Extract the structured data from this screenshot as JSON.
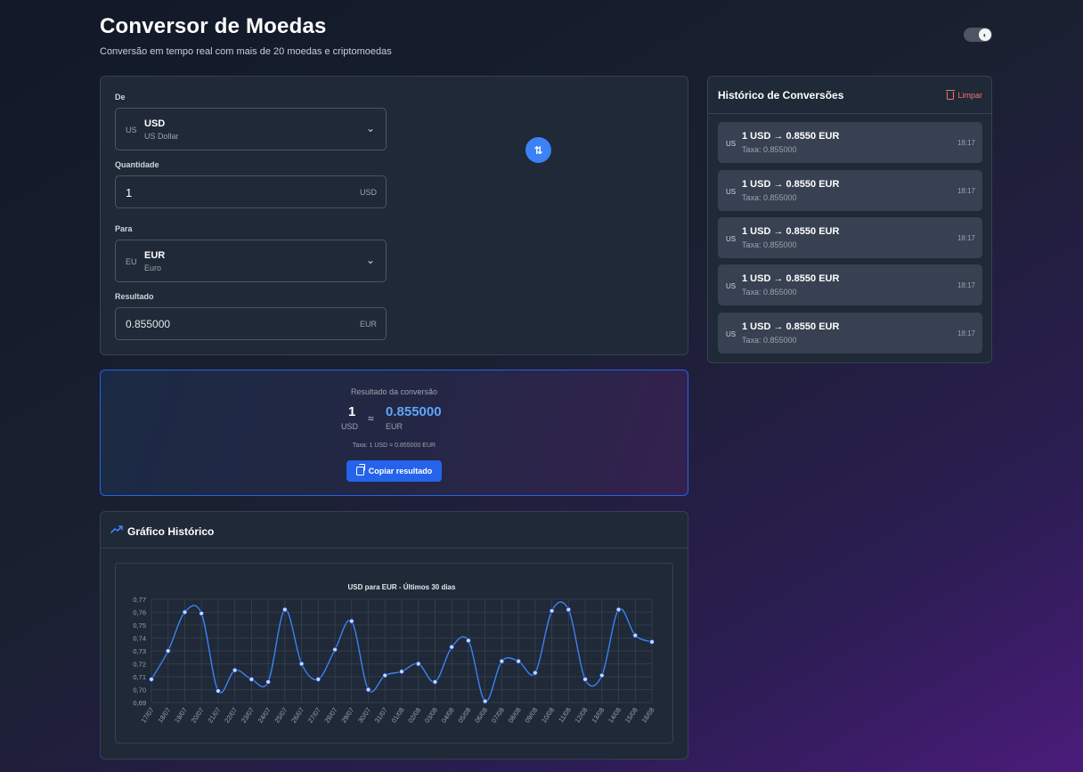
{
  "header": {
    "title": "Conversor de Moedas",
    "subtitle": "Conversão em tempo real com mais de 20 moedas e criptomoedas"
  },
  "converter": {
    "from_label": "De",
    "from": {
      "flag": "US",
      "code": "USD",
      "name": "US Dollar"
    },
    "amount_label": "Quantidade",
    "amount": "1",
    "amount_unit": "USD",
    "to_label": "Para",
    "to": {
      "flag": "EU",
      "code": "EUR",
      "name": "Euro"
    },
    "result_label": "Resultado",
    "result": "0.855000",
    "result_unit": "EUR"
  },
  "result_card": {
    "title": "Resultado da conversão",
    "from_amount": "1",
    "from_code": "USD",
    "approx": "≈",
    "to_amount": "0.855000",
    "to_code": "EUR",
    "rate_text": "Taxa: 1 USD = 0.855000 EUR",
    "copy_label": "Copiar resultado"
  },
  "chart_section": {
    "title": "Gráfico Histórico"
  },
  "chart_data": {
    "type": "line",
    "title": "USD para EUR - Últimos 30 dias",
    "xlabel": "",
    "ylabel": "",
    "ylim": [
      0.69,
      0.77
    ],
    "yticks": [
      "0,77",
      "0,76",
      "0,75",
      "0,74",
      "0,73",
      "0,72",
      "0,71",
      "0,70",
      "0,69"
    ],
    "ytick_values": [
      0.77,
      0.76,
      0.75,
      0.74,
      0.73,
      0.72,
      0.71,
      0.7,
      0.69
    ],
    "categories": [
      "17/07",
      "18/07",
      "19/07",
      "20/07",
      "21/07",
      "22/07",
      "23/07",
      "24/07",
      "25/07",
      "26/07",
      "27/07",
      "28/07",
      "29/07",
      "30/07",
      "31/07",
      "01/08",
      "02/08",
      "03/08",
      "04/08",
      "05/08",
      "06/08",
      "07/08",
      "08/08",
      "09/08",
      "10/08",
      "11/08",
      "12/08",
      "13/08",
      "14/08",
      "15/08",
      "16/08"
    ],
    "series": [
      {
        "values": [
          0.708,
          0.73,
          0.76,
          0.759,
          0.699,
          0.715,
          0.708,
          0.706,
          0.762,
          0.72,
          0.708,
          0.731,
          0.753,
          0.7,
          0.711,
          0.714,
          0.72,
          0.706,
          0.733,
          0.738,
          0.691,
          0.722,
          0.722,
          0.713,
          0.761,
          0.762,
          0.708,
          0.711,
          0.762,
          0.742,
          0.737
        ]
      }
    ],
    "line_color": "#3b82f6",
    "point_fill": "#bfdbfe",
    "grid": true
  },
  "history": {
    "title": "Histórico de Conversões",
    "clear_label": "Limpar",
    "items": [
      {
        "flag": "US",
        "text": "1 USD → 0.8550 EUR",
        "rate": "Taxa: 0.855000",
        "time": "18:17"
      },
      {
        "flag": "US",
        "text": "1 USD → 0.8550 EUR",
        "rate": "Taxa: 0.855000",
        "time": "18:17"
      },
      {
        "flag": "US",
        "text": "1 USD → 0.8550 EUR",
        "rate": "Taxa: 0.855000",
        "time": "18:17"
      },
      {
        "flag": "US",
        "text": "1 USD → 0.8550 EUR",
        "rate": "Taxa: 0.855000",
        "time": "18:17"
      },
      {
        "flag": "US",
        "text": "1 USD → 0.8550 EUR",
        "rate": "Taxa: 0.855000",
        "time": "18:17"
      }
    ]
  },
  "icons": {
    "theme_toggle": "moon-icon",
    "swap": "swap-arrows-icon",
    "chevron": "chevron-down-icon",
    "copy": "copy-icon",
    "trend": "trending-up-icon",
    "trash": "trash-icon"
  },
  "colors": {
    "accent": "#3b82f6",
    "button": "#2563eb",
    "danger": "#f87171",
    "card_bg": "#1f2937",
    "result_value": "#60a5fa"
  }
}
